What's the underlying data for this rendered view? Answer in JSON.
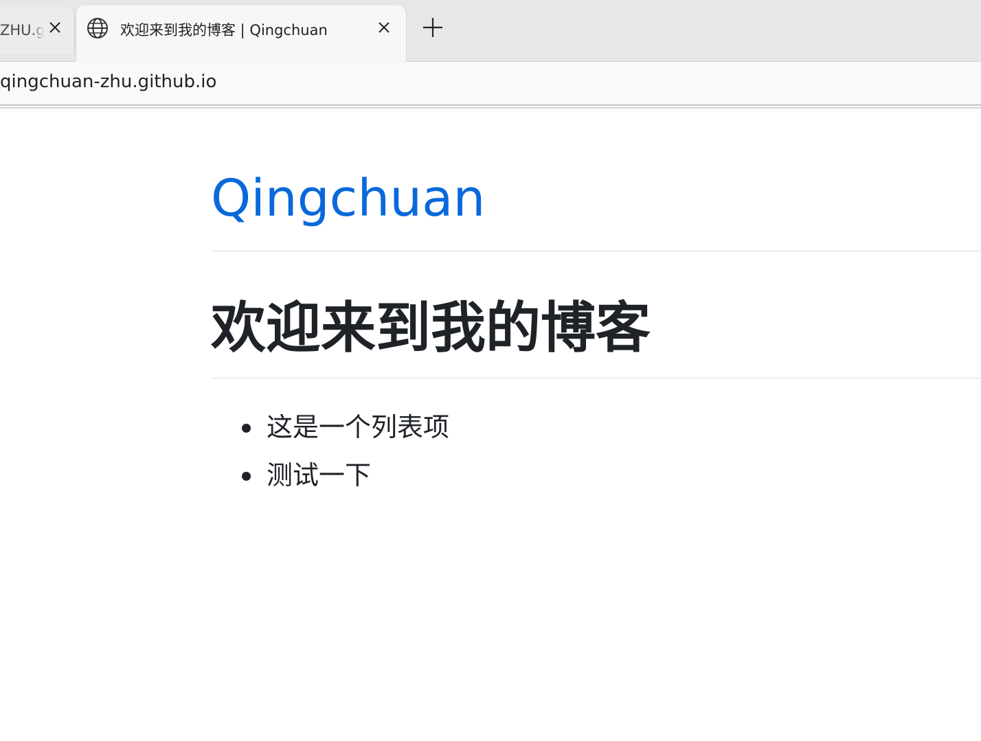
{
  "browser": {
    "tabs": [
      {
        "title": "ZHU.github.io",
        "active": false
      },
      {
        "title": "欢迎来到我的博客 | Qingchuan",
        "active": true
      }
    ],
    "url": "qingchuan-zhu.github.io",
    "icons": {
      "tab_favicon": "globe-icon",
      "tab_close": "close-icon",
      "new_tab": "plus-icon"
    }
  },
  "page": {
    "site_title": "Qingchuan",
    "heading": "欢迎来到我的博客",
    "list_items": [
      "这是一个列表项",
      "测试一下"
    ],
    "colors": {
      "link": "#0969da",
      "text": "#1f2328",
      "rule": "#d8dee4"
    }
  }
}
